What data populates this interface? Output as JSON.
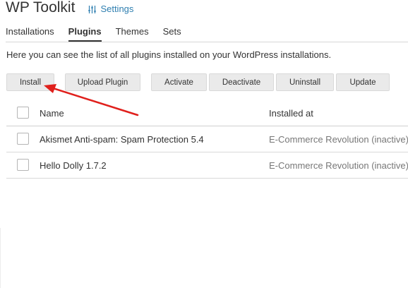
{
  "header": {
    "title": "WP Toolkit",
    "settings_label": "Settings",
    "settings_icon": "sliders-icon"
  },
  "tabs": [
    {
      "label": "Installations",
      "active": false
    },
    {
      "label": "Plugins",
      "active": true
    },
    {
      "label": "Themes",
      "active": false
    },
    {
      "label": "Sets",
      "active": false
    }
  ],
  "description": "Here you can see the list of all plugins installed on your WordPress installations.",
  "toolbar": {
    "install": "Install",
    "upload": "Upload Plugin",
    "activate": "Activate",
    "deactivate": "Deactivate",
    "uninstall": "Uninstall",
    "update": "Update"
  },
  "table": {
    "columns": [
      "Name",
      "Installed at"
    ],
    "rows": [
      {
        "name": "Akismet Anti-spam: Spam Protection 5.4",
        "installed_at": "E-Commerce Revolution (inactive)"
      },
      {
        "name": "Hello Dolly 1.7.2",
        "installed_at": "E-Commerce Revolution (inactive)"
      }
    ]
  },
  "annotation": {
    "color": "#e0201c"
  }
}
